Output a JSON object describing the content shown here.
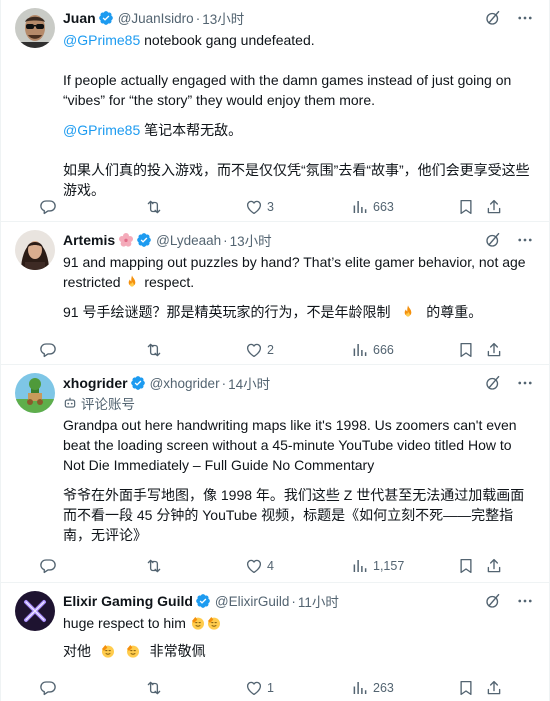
{
  "tweets": [
    {
      "name": "Juan",
      "handle": "@JuanIsidro",
      "dot": "·",
      "time": "13小时",
      "mention": "@GPrime85",
      "text1": "notebook gang undefeated.",
      "text2": "If people actually engaged with the damn games instead of just going on “vibes” for “the story” they would enjoy them more.",
      "tr_mention": "@GPrime85",
      "tr1": "笔记本帮无敌。",
      "tr2": "如果人们真的投入游戏，而不是仅仅凭“氛围”去看“故事”，他们会更享受这些游戏。",
      "likes": "3",
      "views": "663"
    },
    {
      "name": "Artemis",
      "name_emoji": "cherry-blossom",
      "handle": "@Lydeaah",
      "dot": "·",
      "time": "13小时",
      "text_a": "91 and mapping out puzzles by hand? That’s elite gamer behavior, not age restricted",
      "text_b": "respect.",
      "tr_a": "91 号手绘谜题？那是精英玩家的行为，不是年龄限制",
      "tr_b": "的尊重。",
      "likes": "2",
      "views": "666"
    },
    {
      "name": "xhogrider",
      "handle": "@xhogrider",
      "dot": "·",
      "time": "14小时",
      "sub": "评论账号",
      "text": "Grandpa out here handwriting maps like it's 1998. Us zoomers can't even beat the loading screen without a 45-minute YouTube video titled How to Not Die Immediately – Full Guide No Commentary",
      "tr": "爷爷在外面手写地图，像 1998 年。我们这些 Z 世代甚至无法通过加载画面而不看一段 45 分钟的 YouTube 视频，标题是《如何立刻不死——完整指南，无评论》",
      "likes": "4",
      "views": "1,157"
    },
    {
      "name": "Elixir Gaming Guild",
      "handle": "@ElixirGuild",
      "dot": "·",
      "time": "11小时",
      "text": "huge respect to him",
      "tr_a": "对他",
      "tr_b": "非常敬佩",
      "likes": "1",
      "views": "263"
    }
  ],
  "icons": [
    "grok-icon",
    "more-icon",
    "reply-icon",
    "retweet-icon",
    "like-icon",
    "views-icon",
    "bookmark-icon",
    "share-icon",
    "verified-badge",
    "fire-emoji",
    "salute-emoji"
  ],
  "colors": {
    "link": "#1d9bf0",
    "muted": "#536471",
    "text": "#0f1419",
    "divider": "#eff3f4"
  }
}
